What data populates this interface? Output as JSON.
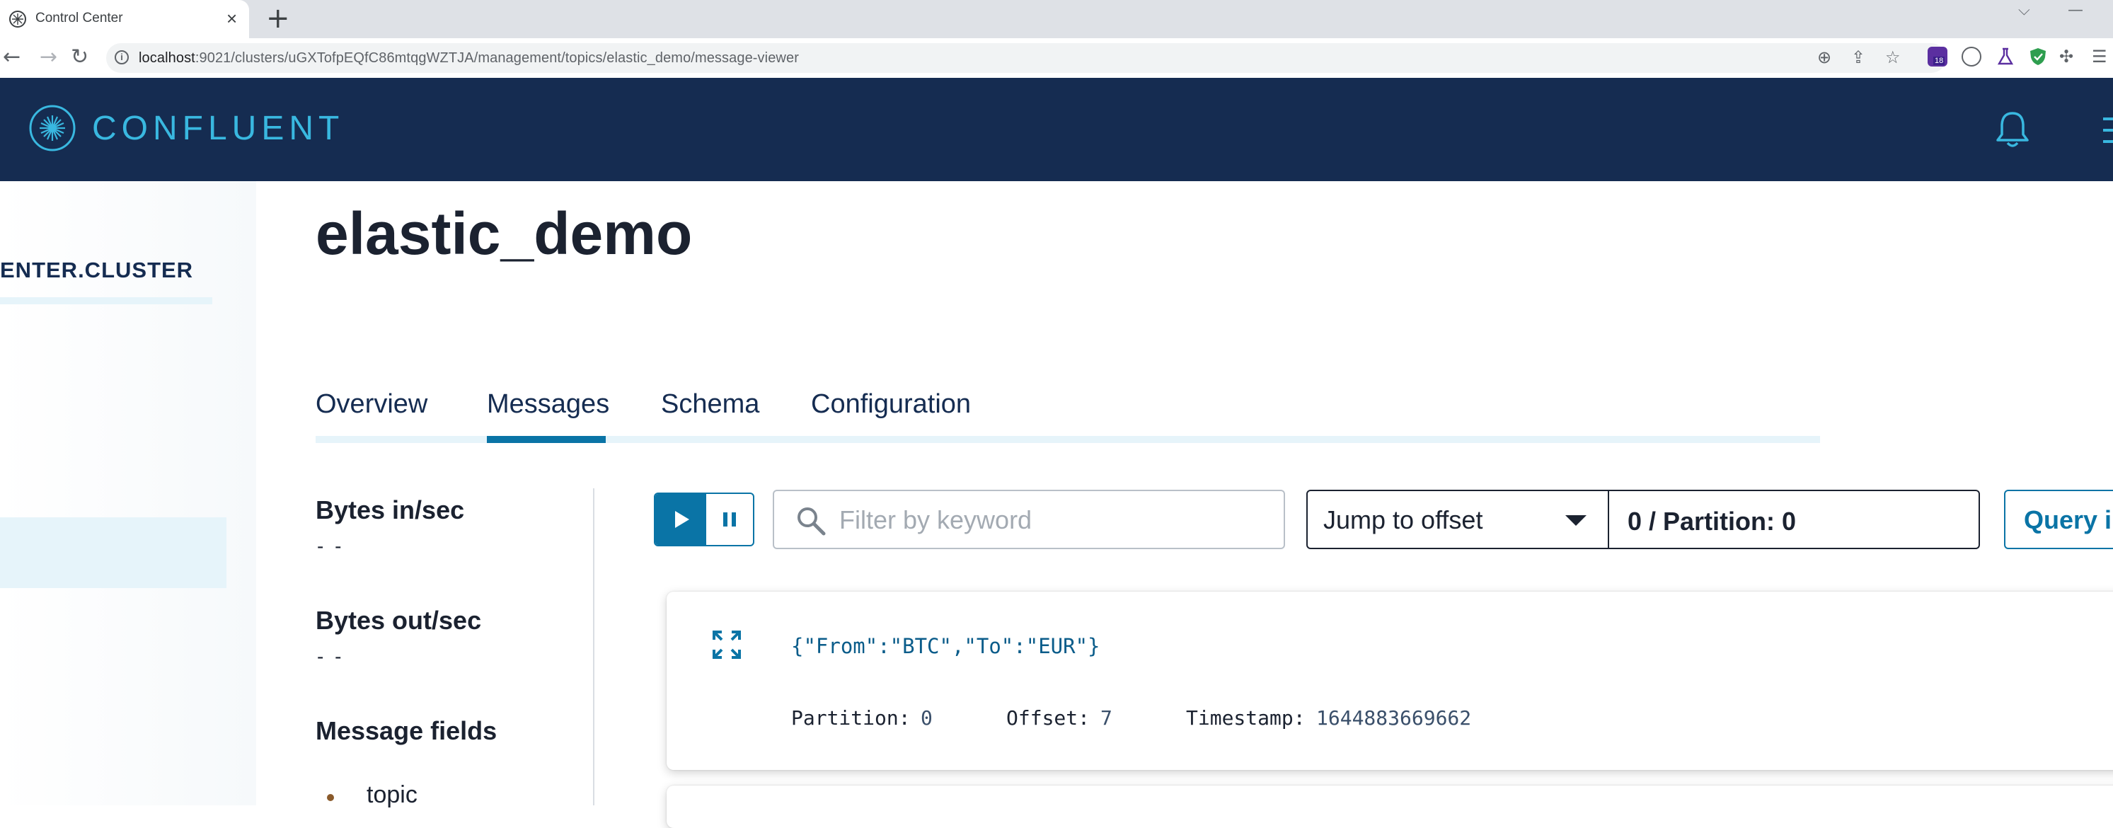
{
  "browser": {
    "tab_title": "Control Center",
    "url_host": "localhost",
    "url_rest": ":9021/clusters/uGXTofpEQfC86mtqgWZTJA/management/topics/elastic_demo/message-viewer",
    "extension_badge": "18"
  },
  "header": {
    "logo_text": "CONFLUENT",
    "accent_color": "#39b8e0",
    "background_color": "#152c51"
  },
  "sidebar": {
    "cluster_name": "ENTER.CLUSTER"
  },
  "main": {
    "topic_title": "elastic_demo",
    "tabs": [
      {
        "label": "Overview",
        "active": false
      },
      {
        "label": "Messages",
        "active": true
      },
      {
        "label": "Schema",
        "active": false
      },
      {
        "label": "Configuration",
        "active": false
      }
    ],
    "metrics": {
      "bytes_in_label": "Bytes in/sec",
      "bytes_in_value": "- -",
      "bytes_out_label": "Bytes out/sec",
      "bytes_out_value": "- -",
      "fields_label": "Message fields",
      "fields": [
        "topic"
      ]
    },
    "controls": {
      "filter_placeholder": "Filter by keyword",
      "jump_label": "Jump to offset",
      "jump_value": "0 / Partition: 0",
      "query_label": "Query i"
    },
    "messages": [
      {
        "key": "{\"From\":\"BTC\",\"To\":\"EUR\"}",
        "partition_label": "Partition:",
        "partition": "0",
        "offset_label": "Offset:",
        "offset": "7",
        "timestamp_label": "Timestamp:",
        "timestamp": "1644883669662"
      }
    ],
    "primary_color": "#0a74a6"
  }
}
